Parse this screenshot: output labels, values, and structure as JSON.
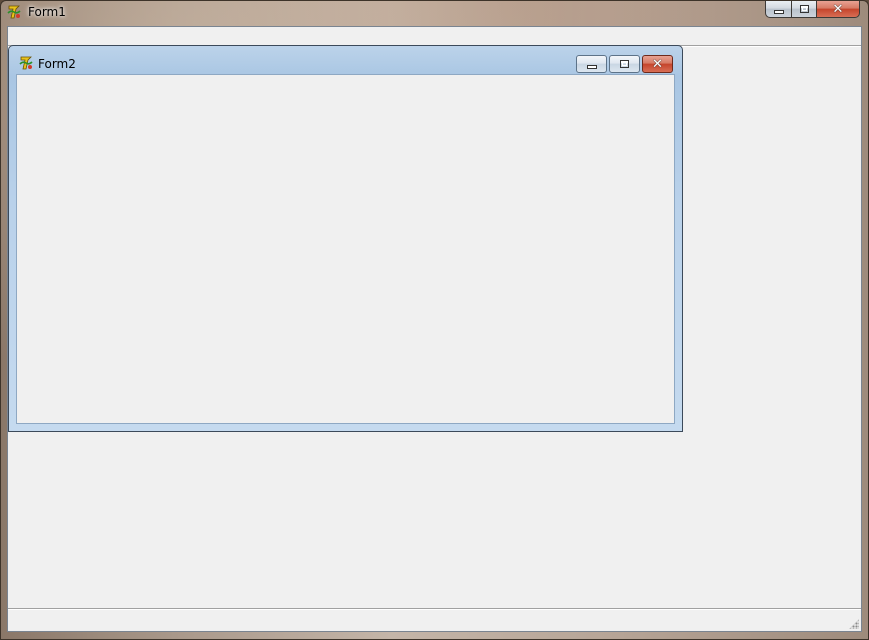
{
  "form1": {
    "title": "Form1",
    "icon": "delphi-app-icon",
    "buttons": {
      "minimize": "minimize-icon",
      "maximize": "maximize-icon",
      "close": "close-icon",
      "close_glyph": "✕"
    }
  },
  "form2": {
    "title": "Form2",
    "icon": "delphi-app-icon",
    "buttons": {
      "minimize": "minimize-icon",
      "restore": "restore-icon",
      "close": "close-icon",
      "close_glyph": "✕"
    }
  },
  "colors": {
    "client_background": "#f0f0f0",
    "child_frame": "#b9d1ea",
    "close_button": "#c5442b"
  }
}
